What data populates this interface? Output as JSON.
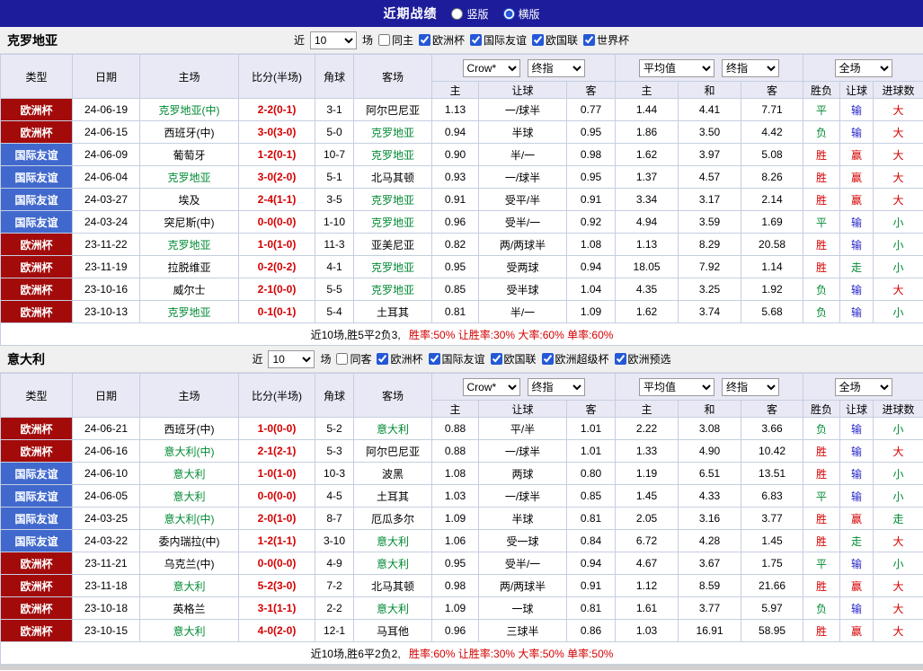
{
  "colors": {
    "red": "#d40000",
    "green": "#008a33",
    "blue": "#2525c8",
    "topbar_bg": "#1d1d9c",
    "accent": "#2458d6"
  },
  "type_colors": {
    "欧洲杯": "#a30b0b",
    "国际友谊": "#4169cd",
    "世界杯": "#a30b0b"
  },
  "top_bar": {
    "title": "近期战绩",
    "options": [
      {
        "label": "竖版",
        "selected": false
      },
      {
        "label": "横版",
        "selected": true
      }
    ]
  },
  "table_head": {
    "cols": [
      "类型",
      "日期",
      "主场",
      "比分(半场)",
      "角球",
      "客场"
    ],
    "sub": [
      "主",
      "让球",
      "客",
      "主",
      "和",
      "客",
      "胜负",
      "让球",
      "进球数"
    ]
  },
  "sections": [
    {
      "team": "克罗地亚",
      "filter": {
        "near": "近",
        "count": "10",
        "unit": "场",
        "same": {
          "label": "同主",
          "checked": false
        },
        "comps": [
          {
            "label": "欧洲杯",
            "checked": true
          },
          {
            "label": "国际友谊",
            "checked": true
          },
          {
            "label": "欧国联",
            "checked": true
          },
          {
            "label": "世界杯",
            "checked": true
          }
        ]
      },
      "controls": {
        "asian_provider": "Crow*",
        "asian_index": "终指",
        "euro_provider": "平均值",
        "euro_index": "终指",
        "scope": "全场"
      },
      "rows": [
        [
          "欧洲杯",
          "24-06-19",
          "克罗地亚(中)",
          "2-2(0-1)",
          "3-1",
          "阿尔巴尼亚",
          "1.13",
          "一/球半",
          "0.77",
          "1.44",
          "4.41",
          "7.71",
          "平",
          "输",
          "大"
        ],
        [
          "欧洲杯",
          "24-06-15",
          "西班牙(中)",
          "3-0(3-0)",
          "5-0",
          "克罗地亚",
          "0.94",
          "半球",
          "0.95",
          "1.86",
          "3.50",
          "4.42",
          "负",
          "输",
          "大"
        ],
        [
          "国际友谊",
          "24-06-09",
          "葡萄牙",
          "1-2(0-1)",
          "10-7",
          "克罗地亚",
          "0.90",
          "半/一",
          "0.98",
          "1.62",
          "3.97",
          "5.08",
          "胜",
          "赢",
          "大"
        ],
        [
          "国际友谊",
          "24-06-04",
          "克罗地亚",
          "3-0(2-0)",
          "5-1",
          "北马其顿",
          "0.93",
          "一/球半",
          "0.95",
          "1.37",
          "4.57",
          "8.26",
          "胜",
          "赢",
          "大"
        ],
        [
          "国际友谊",
          "24-03-27",
          "埃及",
          "2-4(1-1)",
          "3-5",
          "克罗地亚",
          "0.91",
          "受平/半",
          "0.91",
          "3.34",
          "3.17",
          "2.14",
          "胜",
          "赢",
          "大"
        ],
        [
          "国际友谊",
          "24-03-24",
          "突尼斯(中)",
          "0-0(0-0)",
          "1-10",
          "克罗地亚",
          "0.96",
          "受半/一",
          "0.92",
          "4.94",
          "3.59",
          "1.69",
          "平",
          "输",
          "小"
        ],
        [
          "欧洲杯",
          "23-11-22",
          "克罗地亚",
          "1-0(1-0)",
          "11-3",
          "亚美尼亚",
          "0.82",
          "两/两球半",
          "1.08",
          "1.13",
          "8.29",
          "20.58",
          "胜",
          "输",
          "小"
        ],
        [
          "欧洲杯",
          "23-11-19",
          "拉脱维亚",
          "0-2(0-2)",
          "4-1",
          "克罗地亚",
          "0.95",
          "受两球",
          "0.94",
          "18.05",
          "7.92",
          "1.14",
          "胜",
          "走",
          "小"
        ],
        [
          "欧洲杯",
          "23-10-16",
          "威尔士",
          "2-1(0-0)",
          "5-5",
          "克罗地亚",
          "0.85",
          "受半球",
          "1.04",
          "4.35",
          "3.25",
          "1.92",
          "负",
          "输",
          "大"
        ],
        [
          "欧洲杯",
          "23-10-13",
          "克罗地亚",
          "0-1(0-1)",
          "5-4",
          "土耳其",
          "0.81",
          "半/一",
          "1.09",
          "1.62",
          "3.74",
          "5.68",
          "负",
          "输",
          "小"
        ]
      ],
      "summary": {
        "plain": "近10场,胜5平2负3,",
        "stats": "胜率:50% 让胜率:30% 大率:60% 单率:60%"
      }
    },
    {
      "team": "意大利",
      "filter": {
        "near": "近",
        "count": "10",
        "unit": "场",
        "same": {
          "label": "同客",
          "checked": false
        },
        "comps": [
          {
            "label": "欧洲杯",
            "checked": true
          },
          {
            "label": "国际友谊",
            "checked": true
          },
          {
            "label": "欧国联",
            "checked": true
          },
          {
            "label": "欧洲超级杯",
            "checked": true
          },
          {
            "label": "欧洲预选",
            "checked": true
          }
        ]
      },
      "controls": {
        "asian_provider": "Crow*",
        "asian_index": "终指",
        "euro_provider": "平均值",
        "euro_index": "终指",
        "scope": "全场"
      },
      "rows": [
        [
          "欧洲杯",
          "24-06-21",
          "西班牙(中)",
          "1-0(0-0)",
          "5-2",
          "意大利",
          "0.88",
          "平/半",
          "1.01",
          "2.22",
          "3.08",
          "3.66",
          "负",
          "输",
          "小"
        ],
        [
          "欧洲杯",
          "24-06-16",
          "意大利(中)",
          "2-1(2-1)",
          "5-3",
          "阿尔巴尼亚",
          "0.88",
          "一/球半",
          "1.01",
          "1.33",
          "4.90",
          "10.42",
          "胜",
          "输",
          "大"
        ],
        [
          "国际友谊",
          "24-06-10",
          "意大利",
          "1-0(1-0)",
          "10-3",
          "波黑",
          "1.08",
          "两球",
          "0.80",
          "1.19",
          "6.51",
          "13.51",
          "胜",
          "输",
          "小"
        ],
        [
          "国际友谊",
          "24-06-05",
          "意大利",
          "0-0(0-0)",
          "4-5",
          "土耳其",
          "1.03",
          "一/球半",
          "0.85",
          "1.45",
          "4.33",
          "6.83",
          "平",
          "输",
          "小"
        ],
        [
          "国际友谊",
          "24-03-25",
          "意大利(中)",
          "2-0(1-0)",
          "8-7",
          "厄瓜多尔",
          "1.09",
          "半球",
          "0.81",
          "2.05",
          "3.16",
          "3.77",
          "胜",
          "赢",
          "走"
        ],
        [
          "国际友谊",
          "24-03-22",
          "委内瑞拉(中)",
          "1-2(1-1)",
          "3-10",
          "意大利",
          "1.06",
          "受一球",
          "0.84",
          "6.72",
          "4.28",
          "1.45",
          "胜",
          "走",
          "大"
        ],
        [
          "欧洲杯",
          "23-11-21",
          "乌克兰(中)",
          "0-0(0-0)",
          "4-9",
          "意大利",
          "0.95",
          "受半/一",
          "0.94",
          "4.67",
          "3.67",
          "1.75",
          "平",
          "输",
          "小"
        ],
        [
          "欧洲杯",
          "23-11-18",
          "意大利",
          "5-2(3-0)",
          "7-2",
          "北马其顿",
          "0.98",
          "两/两球半",
          "0.91",
          "1.12",
          "8.59",
          "21.66",
          "胜",
          "赢",
          "大"
        ],
        [
          "欧洲杯",
          "23-10-18",
          "英格兰",
          "3-1(1-1)",
          "2-2",
          "意大利",
          "1.09",
          "一球",
          "0.81",
          "1.61",
          "3.77",
          "5.97",
          "负",
          "输",
          "大"
        ],
        [
          "欧洲杯",
          "23-10-15",
          "意大利",
          "4-0(2-0)",
          "12-1",
          "马耳他",
          "0.96",
          "三球半",
          "0.86",
          "1.03",
          "16.91",
          "58.95",
          "胜",
          "赢",
          "大"
        ]
      ],
      "summary": {
        "plain": "近10场,胜6平2负2,",
        "stats": "胜率:60% 让胜率:30% 大率:50% 单率:50%"
      }
    }
  ]
}
